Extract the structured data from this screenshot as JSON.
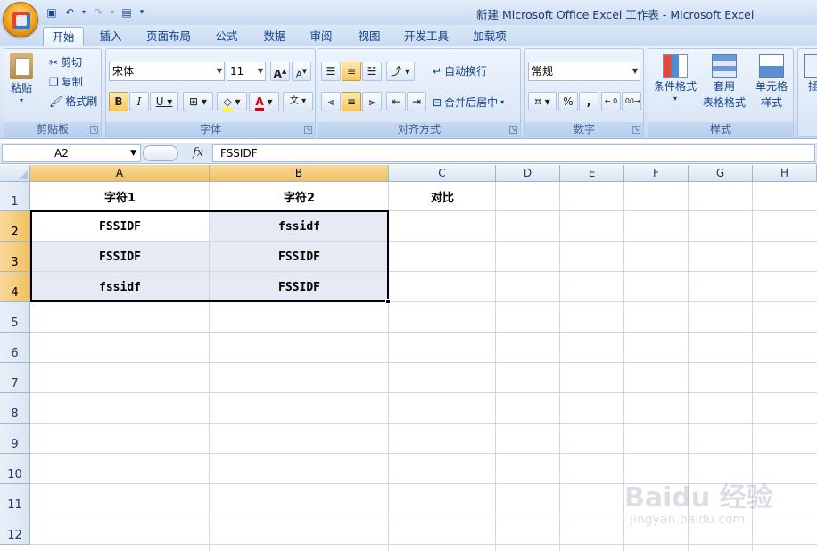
{
  "window": {
    "title": "新建 Microsoft Office Excel 工作表 - Microsoft Excel"
  },
  "tabs": [
    "开始",
    "插入",
    "页面布局",
    "公式",
    "数据",
    "审阅",
    "视图",
    "开发工具",
    "加载项"
  ],
  "ribbon": {
    "clipboard": {
      "paste": "粘贴",
      "cut": "剪切",
      "copy": "复制",
      "format_painter": "格式刷",
      "label": "剪贴板"
    },
    "font": {
      "name": "宋体",
      "size": "11",
      "label": "字体"
    },
    "alignment": {
      "wrap": "自动换行",
      "merge": "合并后居中",
      "label": "对齐方式"
    },
    "number": {
      "format": "常规",
      "label": "数字"
    },
    "styles": {
      "conditional": "条件格式",
      "table_1": "套用",
      "table_2": "表格格式",
      "cell_1": "单元格",
      "cell_2": "样式",
      "label": "样式"
    },
    "insert": {
      "label": "插"
    }
  },
  "formula_bar": {
    "name_box": "A2",
    "fx": "fx",
    "content": "FSSIDF"
  },
  "columns": [
    "A",
    "B",
    "C",
    "D",
    "E",
    "F",
    "G",
    "H"
  ],
  "rows": [
    "1",
    "2",
    "3",
    "4",
    "5",
    "6",
    "7",
    "8",
    "9",
    "10",
    "11",
    "12"
  ],
  "cells": {
    "A1": "字符1",
    "B1": "字符2",
    "C1": "对比",
    "A2": "FSSIDF",
    "B2": "fssidf",
    "A3": "FSSIDF",
    "B3": "FSSIDF",
    "A4": "fssidf",
    "B4": "FSSIDF"
  },
  "watermark": {
    "main": "Baidu 经验",
    "sub": "jingyan.baidu.com"
  }
}
